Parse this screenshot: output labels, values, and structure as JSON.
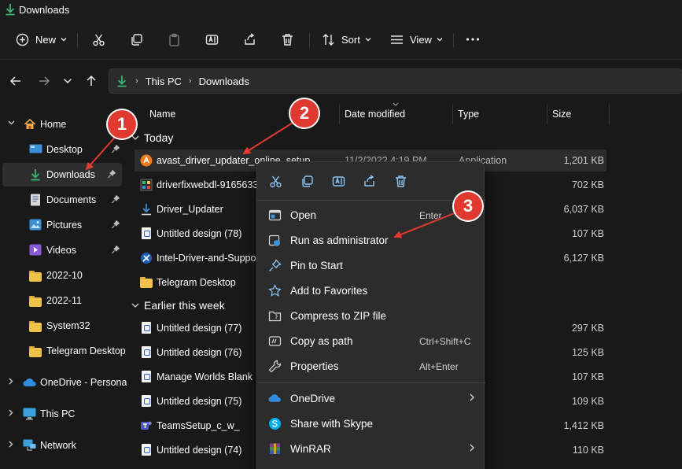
{
  "window": {
    "title": "Downloads"
  },
  "toolbar": {
    "new_label": "New",
    "sort_label": "Sort",
    "view_label": "View"
  },
  "address": {
    "crumbs": [
      "This PC",
      "Downloads"
    ]
  },
  "sidebar": {
    "items": [
      {
        "label": "Home"
      },
      {
        "label": "Desktop"
      },
      {
        "label": "Downloads"
      },
      {
        "label": "Documents"
      },
      {
        "label": "Pictures"
      },
      {
        "label": "Videos"
      },
      {
        "label": "2022-10"
      },
      {
        "label": "2022-11"
      },
      {
        "label": "System32"
      },
      {
        "label": "Telegram Desktop"
      },
      {
        "label": "OneDrive - Personal"
      },
      {
        "label": "This PC"
      },
      {
        "label": "Network"
      }
    ]
  },
  "columns": {
    "name": "Name",
    "date": "Date modified",
    "type": "Type",
    "size": "Size"
  },
  "groups": {
    "today": "Today",
    "earlier": "Earlier this week"
  },
  "files": [
    {
      "name": "avast_driver_updater_online_setup",
      "date": "11/2/2022 4:19 PM",
      "type": "Application",
      "size": "1,201 KB",
      "icon": "avast-icon"
    },
    {
      "name": "driverfixwebdl-91656337",
      "date": "",
      "type": "ation",
      "size": "702 KB",
      "icon": "installer-icon"
    },
    {
      "name": "Driver_Updater",
      "date": "",
      "type": "ation",
      "size": "6,037 KB",
      "icon": "download-icon"
    },
    {
      "name": "Untitled design (78)",
      "date": "",
      "type": "e",
      "size": "107 KB",
      "icon": "document-icon"
    },
    {
      "name": "Intel-Driver-and-Suppor",
      "date": "",
      "type": "ation",
      "size": "6,127 KB",
      "icon": "intel-icon"
    },
    {
      "name": "Telegram Desktop",
      "date": "",
      "type": "lder",
      "size": "",
      "icon": "folder-icon"
    },
    {
      "name": "Untitled design (77)",
      "date": "",
      "type": "e",
      "size": "297 KB",
      "icon": "document-icon"
    },
    {
      "name": "Untitled design (76)",
      "date": "",
      "type": "e",
      "size": "125 KB",
      "icon": "document-icon"
    },
    {
      "name": "Manage Worlds Blank",
      "date": "",
      "type": "e",
      "size": "107 KB",
      "icon": "document-icon"
    },
    {
      "name": "Untitled design (75)",
      "date": "",
      "type": "e",
      "size": "109 KB",
      "icon": "document-icon"
    },
    {
      "name": "TeamsSetup_c_w_",
      "date": "",
      "type": "ation",
      "size": "1,412 KB",
      "icon": "teams-icon"
    },
    {
      "name": "Untitled design (74)",
      "date": "",
      "type": "e",
      "size": "110 KB",
      "icon": "document-icon"
    }
  ],
  "context_menu": {
    "items": [
      {
        "label": "Open",
        "shortcut": "Enter"
      },
      {
        "label": "Run as administrator",
        "shortcut": ""
      },
      {
        "label": "Pin to Start",
        "shortcut": ""
      },
      {
        "label": "Add to Favorites",
        "shortcut": ""
      },
      {
        "label": "Compress to ZIP file",
        "shortcut": ""
      },
      {
        "label": "Copy as path",
        "shortcut": "Ctrl+Shift+C"
      },
      {
        "label": "Properties",
        "shortcut": "Alt+Enter"
      },
      {
        "label": "OneDrive",
        "shortcut": ""
      },
      {
        "label": "Share with Skype",
        "shortcut": ""
      },
      {
        "label": "WinRAR",
        "shortcut": ""
      }
    ]
  },
  "callouts": [
    "1",
    "2",
    "3"
  ],
  "colors": {
    "accent": "#8fc6f5",
    "callout": "#e03a30",
    "folder": "#f0c24a",
    "menu_bg": "#2c2c2c"
  }
}
